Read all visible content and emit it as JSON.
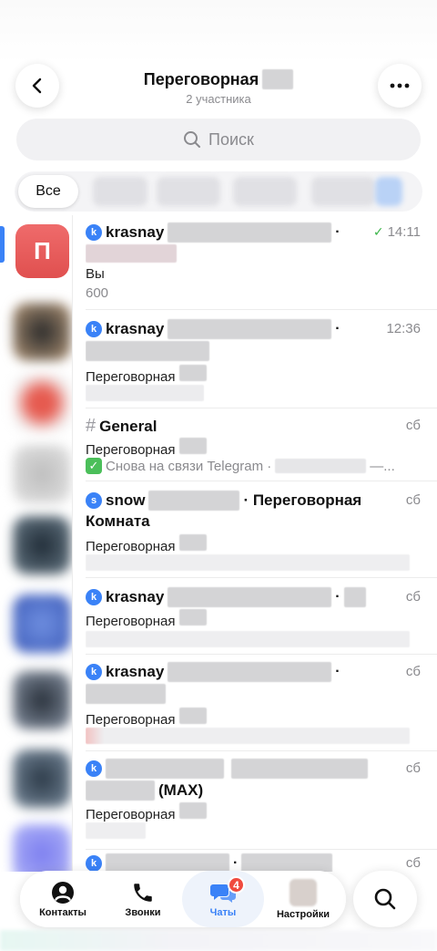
{
  "header": {
    "title": "Переговорная",
    "subtitle": "2 участника"
  },
  "search": {
    "placeholder": "Поиск"
  },
  "filters": {
    "all_label": "Все"
  },
  "folders": {
    "first_letter": "П"
  },
  "chats": [
    {
      "badge": "k",
      "name": "krasnay",
      "time": "14:11",
      "read": true,
      "line2": "Вы",
      "line3": "600"
    },
    {
      "badge": "k",
      "name": "krasnay",
      "time": "12:36",
      "line3": "Переговорная"
    },
    {
      "badge": "#",
      "name": "General",
      "time": "сб",
      "line2": "Переговорная",
      "line3": "Снова на связи Telegram ·",
      "line3_tail": "—..."
    },
    {
      "badge": "s",
      "name": "snow",
      "name_tail": "· Переговорная",
      "name_line2": "Комната",
      "time": "сб",
      "line3": "Переговорная"
    },
    {
      "badge": "k",
      "name": "krasnay",
      "time": "сб",
      "line2": "Переговорная"
    },
    {
      "badge": "k",
      "name": "krasnay",
      "time": "сб",
      "line3": "Переговорная"
    },
    {
      "badge": "k",
      "name_line2": "(MAX)",
      "time": "сб",
      "line3": "Переговорная"
    },
    {
      "badge": "k",
      "time": "сб"
    }
  ],
  "tabbar": {
    "contacts": "Контакты",
    "calls": "Звонки",
    "chats": "Чаты",
    "chats_badge": "4",
    "settings": "Настройки"
  },
  "colors": {
    "accent": "#3a82f7",
    "badge_red": "#f04a3e",
    "read_check": "#3cb54a"
  }
}
